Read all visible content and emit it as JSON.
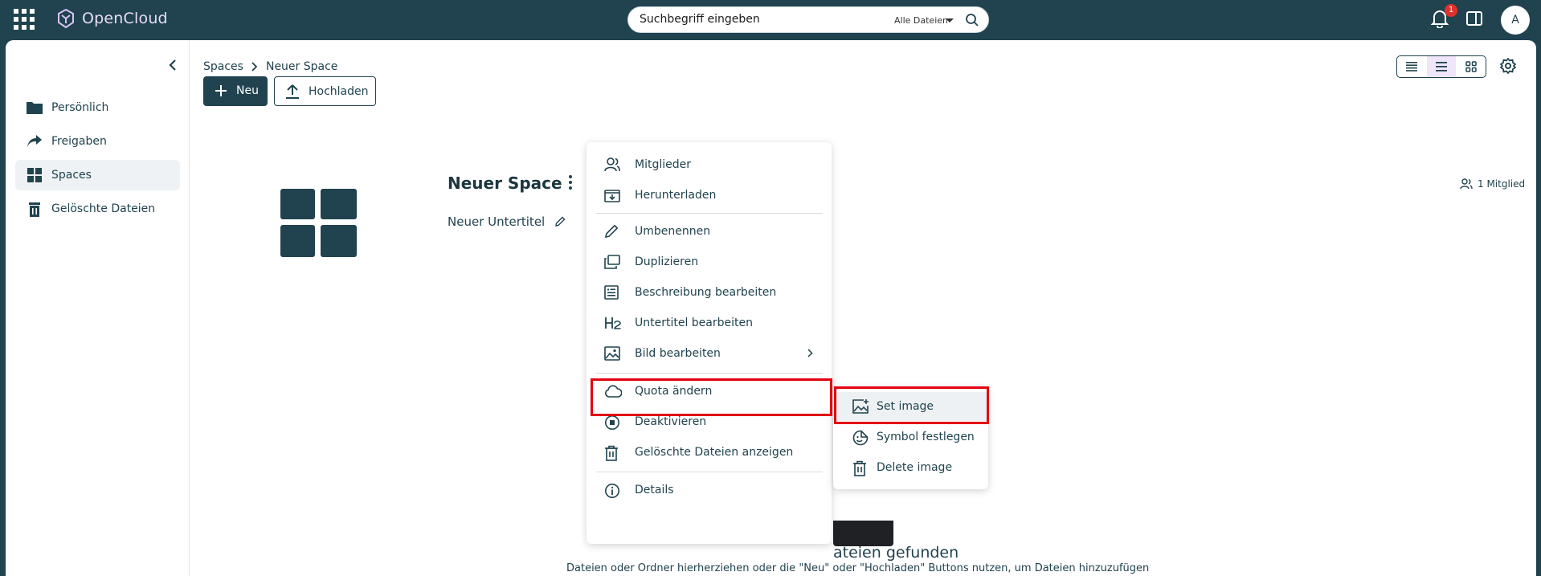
{
  "app": {
    "name": "OpenCloud"
  },
  "search": {
    "placeholder": "Suchbegriff eingeben",
    "scope": "Alle Dateien"
  },
  "notifications": {
    "count": "1"
  },
  "user": {
    "initial": "A"
  },
  "sidebar": {
    "items": [
      {
        "label": "Persönlich"
      },
      {
        "label": "Freigaben"
      },
      {
        "label": "Spaces"
      },
      {
        "label": "Gelöschte Dateien"
      }
    ]
  },
  "breadcrumb": {
    "root": "Spaces",
    "current": "Neuer Space"
  },
  "toolbar": {
    "new_label": "Neu",
    "upload_label": "Hochladen"
  },
  "space": {
    "title": "Neuer Space",
    "subtitle": "Neuer Untertitel",
    "members": "1 Mitglied"
  },
  "empty": {
    "title": "ateien gefunden",
    "description": "Dateien oder Ordner hierherziehen oder die \"Neu\" oder \"Hochladen\" Buttons nutzen, um Dateien hinzuzufügen"
  },
  "context_menu": {
    "items": [
      {
        "label": "Mitglieder"
      },
      {
        "label": "Herunterladen"
      },
      {
        "label": "Umbenennen"
      },
      {
        "label": "Duplizieren"
      },
      {
        "label": "Beschreibung bearbeiten"
      },
      {
        "label": "Untertitel bearbeiten"
      },
      {
        "label": "Bild bearbeiten"
      },
      {
        "label": "Quota ändern"
      },
      {
        "label": "Deaktivieren"
      },
      {
        "label": "Gelöschte Dateien anzeigen"
      },
      {
        "label": "Details"
      }
    ]
  },
  "submenu": {
    "items": [
      {
        "label": "Set image"
      },
      {
        "label": "Symbol festlegen"
      },
      {
        "label": "Delete image"
      }
    ]
  },
  "colors": {
    "brand": "#20434f",
    "highlight": "#e3000f",
    "accent": "#e9dcfa"
  }
}
